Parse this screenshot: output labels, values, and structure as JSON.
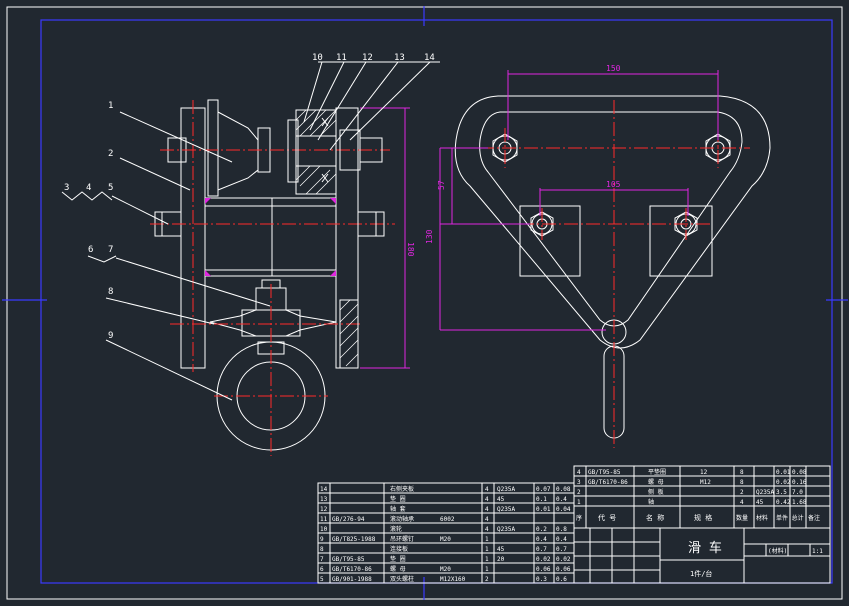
{
  "drawing": {
    "title": "滑 车",
    "subtitle": "1件/台",
    "scale": "1:1",
    "sheet": "(材料)"
  },
  "callouts": [
    "1",
    "2",
    "3",
    "4",
    "5",
    "6",
    "7",
    "8",
    "9",
    "10",
    "11",
    "12",
    "13",
    "14"
  ],
  "dimensions": {
    "total_height": "180",
    "top_width": "150",
    "inner_width": "105",
    "height_57": "57",
    "height_130": "130"
  },
  "bom_left": [
    {
      "no": "14",
      "code": "",
      "name": "右侧夹板",
      "qty": "4",
      "mat": "Q235A",
      "w1": "0.07",
      "w2": "0.08"
    },
    {
      "no": "13",
      "code": "",
      "name": "垫 圈",
      "qty": "4",
      "mat": "45",
      "w1": "0.1",
      "w2": "0.4"
    },
    {
      "no": "12",
      "code": "",
      "name": "轴 套",
      "qty": "4",
      "mat": "Q235A",
      "w1": "0.01",
      "w2": "0.04"
    },
    {
      "no": "11",
      "code": "GB/276-94",
      "name": "滚动轴承",
      "qty": "4",
      "mat": "6002",
      "w1": "",
      "w2": ""
    },
    {
      "no": "10",
      "code": "",
      "name": "滚轮",
      "qty": "4",
      "mat": "Q235A",
      "w1": "0.2",
      "w2": "0.8"
    },
    {
      "no": "9",
      "code": "GB/T825-1988",
      "name": "吊环螺钉",
      "qty": "1",
      "mat": "M20",
      "w1": "0.4",
      "w2": "0.4"
    },
    {
      "no": "8",
      "code": "",
      "name": "连接板",
      "qty": "1",
      "mat": "45",
      "w1": "0.7",
      "w2": "0.7"
    },
    {
      "no": "7",
      "code": "GB/T95-85",
      "name": "垫 圈",
      "qty": "1",
      "mat": "20",
      "w1": "0.02",
      "w2": "0.02"
    },
    {
      "no": "6",
      "code": "GB/T6170-86",
      "name": "螺 母",
      "qty": "1",
      "mat": "M20",
      "w1": "0.06",
      "w2": "0.06"
    },
    {
      "no": "5",
      "code": "GB/901-1988",
      "name": "双头螺柱",
      "qty": "2",
      "mat": "M12X160",
      "w1": "0.3",
      "w2": "0.6"
    }
  ],
  "bom_right": [
    {
      "no": "4",
      "code": "GB/T95-85",
      "name": "平垫圈",
      "spec": "12",
      "qty": "8",
      "mat": "",
      "w1": "0.01",
      "w2": "0.08"
    },
    {
      "no": "3",
      "code": "GB/T6170-86",
      "name": "螺 母",
      "spec": "M12",
      "qty": "8",
      "mat": "",
      "w1": "0.02",
      "w2": "0.16"
    },
    {
      "no": "2",
      "code": "",
      "name": "侧 板",
      "spec": "",
      "qty": "2",
      "mat": "Q235A",
      "w1": "3.5",
      "w2": "7.0"
    },
    {
      "no": "1",
      "code": "",
      "name": "轴",
      "spec": "",
      "qty": "4",
      "mat": "45",
      "w1": "0.42",
      "w2": "1.68"
    }
  ],
  "bom_header": {
    "no": "序",
    "code": "代 号",
    "name": "名 称",
    "spec": "规 格",
    "qty": "数量",
    "mat": "材料",
    "weight": "单件 总计",
    "note": "备注"
  }
}
